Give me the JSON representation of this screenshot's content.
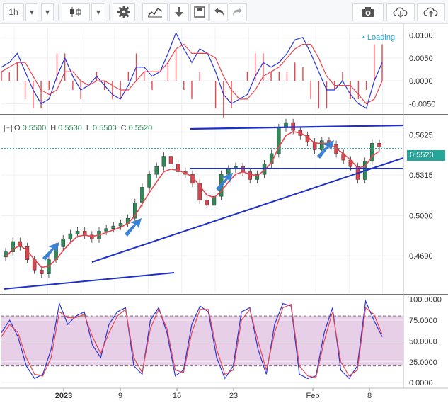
{
  "toolbar": {
    "interval_label": "1h",
    "icons": [
      "chevron-down-icon",
      "candlestick-icon",
      "chevron-down-icon",
      "gear-icon",
      "indicators-icon",
      "download-icon",
      "save-icon",
      "undo-icon",
      "redo-icon",
      "camera-icon",
      "cloud-download-icon",
      "cloud-upload-icon"
    ]
  },
  "colors": {
    "price_blue": "#2a35d6",
    "ma_red": "#e8474f",
    "trend_line": "#1f2fc7",
    "arrow_blue": "#3b82d6",
    "stoch_fill": "#e7cfe8",
    "green_level": "#26a69a",
    "candle_up": "#2e8b57",
    "candle_down": "#d9434b"
  },
  "ohlc": {
    "o_label": "O",
    "o_value": "0.5500",
    "h_label": "H",
    "h_value": "0.5530",
    "l_label": "L",
    "l_value": "0.5500",
    "c_label": "C",
    "c_value": "0.5520"
  },
  "loading_label": "Loading",
  "last_price_label": "0.5520",
  "chart_data": [
    {
      "type": "line",
      "panel": "oscillator (MACD-style)",
      "y_ticks": [
        "0.0100",
        "0.0050",
        "0.0000",
        "-0.0050"
      ],
      "y_tick_values": [
        0.01,
        0.005,
        0,
        -0.005
      ],
      "ylim": [
        -0.0068,
        0.0118
      ],
      "x": [
        0,
        2,
        4,
        6,
        8,
        10,
        12,
        14,
        16,
        18,
        20,
        22,
        24,
        26,
        28,
        30,
        32,
        34,
        36,
        38,
        40,
        42,
        44,
        46,
        48,
        50,
        52,
        54,
        56,
        58,
        60,
        62,
        64,
        66,
        68,
        70,
        72,
        74,
        76,
        78,
        80,
        82,
        84,
        86,
        88,
        90,
        92,
        94,
        96
      ],
      "series": [
        {
          "values": [
            0.003,
            0.004,
            0.006,
            0.002,
            -0.002,
            -0.005,
            -0.004,
            0.001,
            0.005,
            0.001,
            -0.002,
            -0.001,
            0.001,
            -0.001,
            -0.003,
            -0.004,
            -0.001,
            0.003,
            0.003,
            0.001,
            0.002,
            0.006,
            0.0105,
            0.007,
            0.004,
            0.007,
            0.006,
            0.002,
            -0.003,
            -0.005,
            -0.004,
            -0.003,
            0.001,
            0.004,
            0.003,
            0.004,
            0.006,
            0.009,
            0.0095,
            0.006,
            0.002,
            -0.002,
            -0.002,
            0.0,
            -0.003,
            -0.005,
            -0.006,
            0.0,
            0.004
          ]
        },
        {
          "values": [
            0.002,
            0.003,
            0.004,
            0.004,
            0.001,
            -0.002,
            -0.003,
            -0.002,
            0.002,
            0.002,
            0.0,
            -0.001,
            0.0,
            0.0,
            -0.001,
            -0.002,
            -0.002,
            0.0,
            0.002,
            0.002,
            0.002,
            0.004,
            0.007,
            0.008,
            0.006,
            0.006,
            0.006,
            0.005,
            0.001,
            -0.002,
            -0.004,
            -0.004,
            -0.002,
            0.001,
            0.002,
            0.003,
            0.005,
            0.007,
            0.008,
            0.008,
            0.005,
            0.001,
            -0.001,
            -0.001,
            -0.001,
            -0.003,
            -0.005,
            -0.004,
            0.0
          ]
        }
      ]
    },
    {
      "type": "candlestick",
      "panel": "price",
      "y_ticks": [
        "0.5625",
        "0.5315",
        "0.5000",
        "0.4690"
      ],
      "y_tick_values": [
        0.5625,
        0.5315,
        0.5,
        0.469
      ],
      "ylim": [
        0.44,
        0.577
      ],
      "x_ticks": [
        "2023",
        "9",
        "16",
        "23",
        "Feb",
        "8"
      ],
      "x_tick_positions": [
        11,
        21,
        31,
        41,
        55,
        65
      ],
      "xlim": [
        0,
        71
      ],
      "series": [
        {
          "name": "close",
          "values": [
            0.472,
            0.48,
            0.476,
            0.466,
            0.458,
            0.455,
            0.466,
            0.476,
            0.482,
            0.486,
            0.488,
            0.485,
            0.482,
            0.488,
            0.49,
            0.492,
            0.494,
            0.498,
            0.51,
            0.522,
            0.532,
            0.538,
            0.546,
            0.54,
            0.534,
            0.532,
            0.525,
            0.512,
            0.508,
            0.515,
            0.532,
            0.536,
            0.538,
            0.534,
            0.528,
            0.532,
            0.54,
            0.548,
            0.568,
            0.572,
            0.566,
            0.562,
            0.557,
            0.551,
            0.558,
            0.555,
            0.548,
            0.543,
            0.538,
            0.528,
            0.542,
            0.556,
            0.553
          ]
        },
        {
          "name": "ma_fast",
          "values": [
            0.468,
            0.474,
            0.477,
            0.473,
            0.466,
            0.46,
            0.461,
            0.466,
            0.473,
            0.479,
            0.484,
            0.485,
            0.484,
            0.485,
            0.487,
            0.489,
            0.491,
            0.494,
            0.5,
            0.509,
            0.518,
            0.526,
            0.534,
            0.536,
            0.535,
            0.533,
            0.53,
            0.523,
            0.516,
            0.514,
            0.519,
            0.526,
            0.532,
            0.534,
            0.532,
            0.531,
            0.535,
            0.541,
            0.553,
            0.562,
            0.565,
            0.564,
            0.561,
            0.556,
            0.556,
            0.556,
            0.552,
            0.548,
            0.543,
            0.537,
            0.538,
            0.546,
            0.55
          ]
        }
      ],
      "support_line": [
        [
          0,
          0.5315
        ],
        [
          0,
          0.5315
        ]
      ],
      "annotations": [
        "up-arrow",
        "up-arrow",
        "up-arrow",
        "up-arrow",
        "up-arrow"
      ]
    },
    {
      "type": "line",
      "panel": "stochastic",
      "y_ticks": [
        "100.0000",
        "75.0000",
        "50.0000",
        "25.0000",
        "0.0000"
      ],
      "y_tick_values": [
        100,
        75,
        50,
        25,
        0
      ],
      "ylim": [
        -5,
        104
      ],
      "band": [
        20,
        80
      ],
      "x": [
        0,
        1.5,
        3,
        4.5,
        6,
        7.5,
        9,
        10.5,
        12,
        13.5,
        15,
        16.5,
        18,
        19.5,
        21,
        22.5,
        24,
        25.5,
        27,
        28.5,
        30,
        31.5,
        33,
        34.5,
        36,
        37.5,
        39,
        40.5,
        42,
        43.5,
        45,
        46.5,
        48,
        49.5,
        51,
        52.5,
        54,
        55.5,
        57,
        58.5,
        60,
        61.5,
        63,
        64.5,
        66,
        67.5,
        69
      ],
      "series": [
        {
          "values": [
            60,
            75,
            55,
            20,
            5,
            10,
            40,
            95,
            70,
            80,
            85,
            45,
            30,
            70,
            85,
            90,
            20,
            10,
            75,
            90,
            60,
            8,
            15,
            70,
            92,
            85,
            30,
            5,
            20,
            85,
            90,
            40,
            10,
            70,
            95,
            92,
            10,
            5,
            8,
            60,
            90,
            15,
            5,
            20,
            98,
            75,
            55
          ]
        },
        {
          "values": [
            55,
            70,
            60,
            30,
            10,
            8,
            30,
            85,
            78,
            78,
            82,
            55,
            35,
            60,
            80,
            88,
            30,
            12,
            65,
            88,
            65,
            15,
            12,
            60,
            88,
            88,
            40,
            10,
            15,
            75,
            88,
            50,
            15,
            60,
            90,
            94,
            20,
            8,
            6,
            50,
            85,
            25,
            8,
            15,
            90,
            82,
            58
          ]
        }
      ]
    }
  ]
}
